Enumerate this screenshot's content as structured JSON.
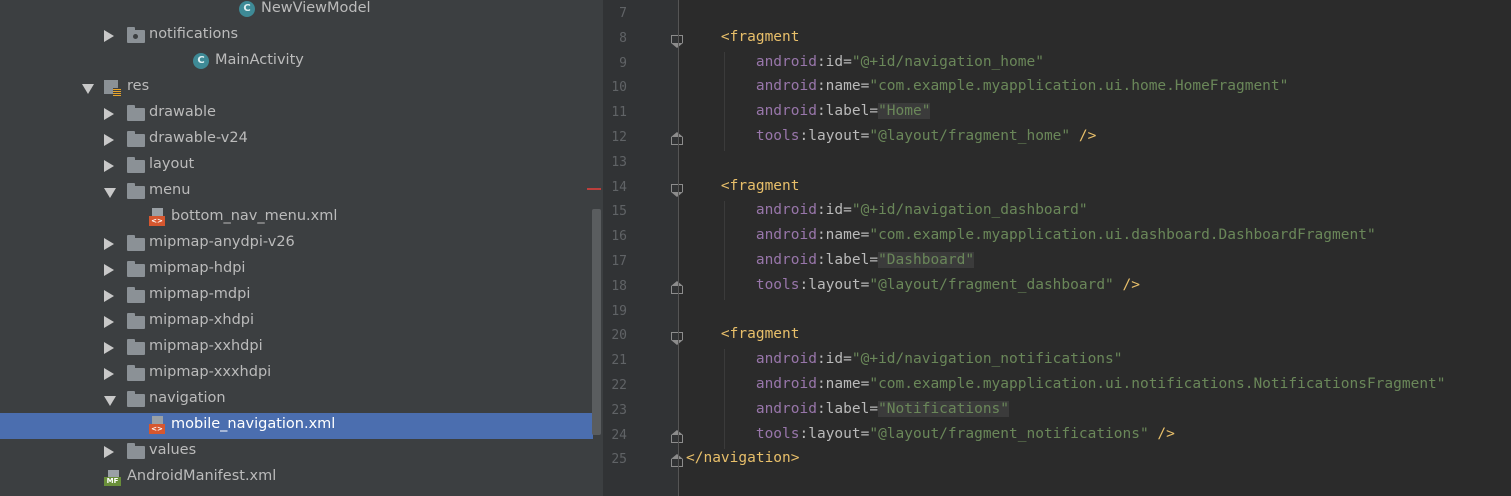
{
  "project_tree": {
    "items": [
      {
        "indent": 3,
        "arrow": "",
        "icon": "class",
        "label": "NewViewModel"
      },
      {
        "indent": 2,
        "arrow": "right",
        "icon": "folder-package",
        "label": "notifications"
      },
      {
        "indent": 2,
        "arrow": "",
        "icon": "class",
        "label": "MainActivity"
      },
      {
        "indent": 1,
        "arrow": "down",
        "icon": "res-folder",
        "label": "res"
      },
      {
        "indent": 2,
        "arrow": "right",
        "icon": "folder",
        "label": "drawable"
      },
      {
        "indent": 2,
        "arrow": "right",
        "icon": "folder",
        "label": "drawable-v24"
      },
      {
        "indent": 2,
        "arrow": "right",
        "icon": "folder",
        "label": "layout"
      },
      {
        "indent": 2,
        "arrow": "down",
        "icon": "folder",
        "label": "menu"
      },
      {
        "indent": 3,
        "arrow": "",
        "icon": "xml",
        "label": "bottom_nav_menu.xml"
      },
      {
        "indent": 2,
        "arrow": "right",
        "icon": "folder",
        "label": "mipmap-anydpi-v26"
      },
      {
        "indent": 2,
        "arrow": "right",
        "icon": "folder",
        "label": "mipmap-hdpi"
      },
      {
        "indent": 2,
        "arrow": "right",
        "icon": "folder",
        "label": "mipmap-mdpi"
      },
      {
        "indent": 2,
        "arrow": "right",
        "icon": "folder",
        "label": "mipmap-xhdpi"
      },
      {
        "indent": 2,
        "arrow": "right",
        "icon": "folder",
        "label": "mipmap-xxhdpi"
      },
      {
        "indent": 2,
        "arrow": "right",
        "icon": "folder",
        "label": "mipmap-xxxhdpi"
      },
      {
        "indent": 2,
        "arrow": "down",
        "icon": "folder",
        "label": "navigation"
      },
      {
        "indent": 3,
        "arrow": "",
        "icon": "xml",
        "label": "mobile_navigation.xml",
        "selected": true
      },
      {
        "indent": 2,
        "arrow": "right",
        "icon": "folder",
        "label": "values"
      },
      {
        "indent": 1,
        "arrow": "",
        "icon": "manifest",
        "label": "AndroidManifest.xml"
      }
    ]
  },
  "icons": {
    "class_letter": "C",
    "xml_tag": "<>",
    "manifest_tag": "MF"
  },
  "editor": {
    "lines": [
      {
        "n": "7",
        "fold": "",
        "tokens": []
      },
      {
        "n": "8",
        "fold": "open",
        "tokens": [
          [
            "    ",
            "plain"
          ],
          [
            "<fragment",
            "br"
          ]
        ]
      },
      {
        "n": "9",
        "fold": "",
        "tokens": [
          [
            "        ",
            "plain"
          ],
          [
            "android",
            "ns"
          ],
          [
            ":id=",
            "attr"
          ],
          [
            "\"@+id/navigation_home\"",
            "str"
          ]
        ]
      },
      {
        "n": "10",
        "fold": "",
        "tokens": [
          [
            "        ",
            "plain"
          ],
          [
            "android",
            "ns"
          ],
          [
            ":name=",
            "attr"
          ],
          [
            "\"com.example.myapplication.ui.home.HomeFragment\"",
            "str"
          ]
        ]
      },
      {
        "n": "11",
        "fold": "",
        "tokens": [
          [
            "        ",
            "plain"
          ],
          [
            "android",
            "ns"
          ],
          [
            ":label=",
            "attr"
          ],
          [
            "\"Home\"",
            "strhl"
          ]
        ]
      },
      {
        "n": "12",
        "fold": "close",
        "tokens": [
          [
            "        ",
            "plain"
          ],
          [
            "tools",
            "ns"
          ],
          [
            ":layout=",
            "attr"
          ],
          [
            "\"@layout/fragment_home\"",
            "str"
          ],
          [
            " />",
            "br"
          ]
        ]
      },
      {
        "n": "13",
        "fold": "",
        "tokens": []
      },
      {
        "n": "14",
        "fold": "open",
        "marker": true,
        "tokens": [
          [
            "    ",
            "plain"
          ],
          [
            "<fragment",
            "br"
          ]
        ]
      },
      {
        "n": "15",
        "fold": "",
        "tokens": [
          [
            "        ",
            "plain"
          ],
          [
            "android",
            "ns"
          ],
          [
            ":id=",
            "attr"
          ],
          [
            "\"@+id/navigation_dashboard\"",
            "str"
          ]
        ]
      },
      {
        "n": "16",
        "fold": "",
        "tokens": [
          [
            "        ",
            "plain"
          ],
          [
            "android",
            "ns"
          ],
          [
            ":name=",
            "attr"
          ],
          [
            "\"com.example.myapplication.ui.dashboard.DashboardFragment\"",
            "str"
          ]
        ]
      },
      {
        "n": "17",
        "fold": "",
        "tokens": [
          [
            "        ",
            "plain"
          ],
          [
            "android",
            "ns"
          ],
          [
            ":label=",
            "attr"
          ],
          [
            "\"Dashboard\"",
            "strhl"
          ]
        ]
      },
      {
        "n": "18",
        "fold": "close",
        "tokens": [
          [
            "        ",
            "plain"
          ],
          [
            "tools",
            "ns"
          ],
          [
            ":layout=",
            "attr"
          ],
          [
            "\"@layout/fragment_dashboard\"",
            "str"
          ],
          [
            " />",
            "br"
          ]
        ]
      },
      {
        "n": "19",
        "fold": "",
        "tokens": []
      },
      {
        "n": "20",
        "fold": "open",
        "tokens": [
          [
            "    ",
            "plain"
          ],
          [
            "<fragment",
            "br"
          ]
        ]
      },
      {
        "n": "21",
        "fold": "",
        "tokens": [
          [
            "        ",
            "plain"
          ],
          [
            "android",
            "ns"
          ],
          [
            ":id=",
            "attr"
          ],
          [
            "\"@+id/navigation_notifications\"",
            "str"
          ]
        ]
      },
      {
        "n": "22",
        "fold": "",
        "tokens": [
          [
            "        ",
            "plain"
          ],
          [
            "android",
            "ns"
          ],
          [
            ":name=",
            "attr"
          ],
          [
            "\"com.example.myapplication.ui.notifications.NotificationsFragment\"",
            "str"
          ]
        ]
      },
      {
        "n": "23",
        "fold": "",
        "tokens": [
          [
            "        ",
            "plain"
          ],
          [
            "android",
            "ns"
          ],
          [
            ":label=",
            "attr"
          ],
          [
            "\"Notifications\"",
            "strhl"
          ]
        ]
      },
      {
        "n": "24",
        "fold": "close",
        "tokens": [
          [
            "        ",
            "plain"
          ],
          [
            "tools",
            "ns"
          ],
          [
            ":layout=",
            "attr"
          ],
          [
            "\"@layout/fragment_notifications\"",
            "str"
          ],
          [
            " />",
            "br"
          ]
        ]
      },
      {
        "n": "25",
        "fold": "close",
        "tokens": [
          [
            "</navigation>",
            "br"
          ]
        ]
      }
    ]
  },
  "colors": {
    "tree_bg": "#3c3f41",
    "selection": "#4b6eaf",
    "editor_bg": "#2b2b2b",
    "tag": "#e8bf6a",
    "namespace": "#9876aa",
    "string": "#6a8759",
    "line_number": "#606366"
  }
}
